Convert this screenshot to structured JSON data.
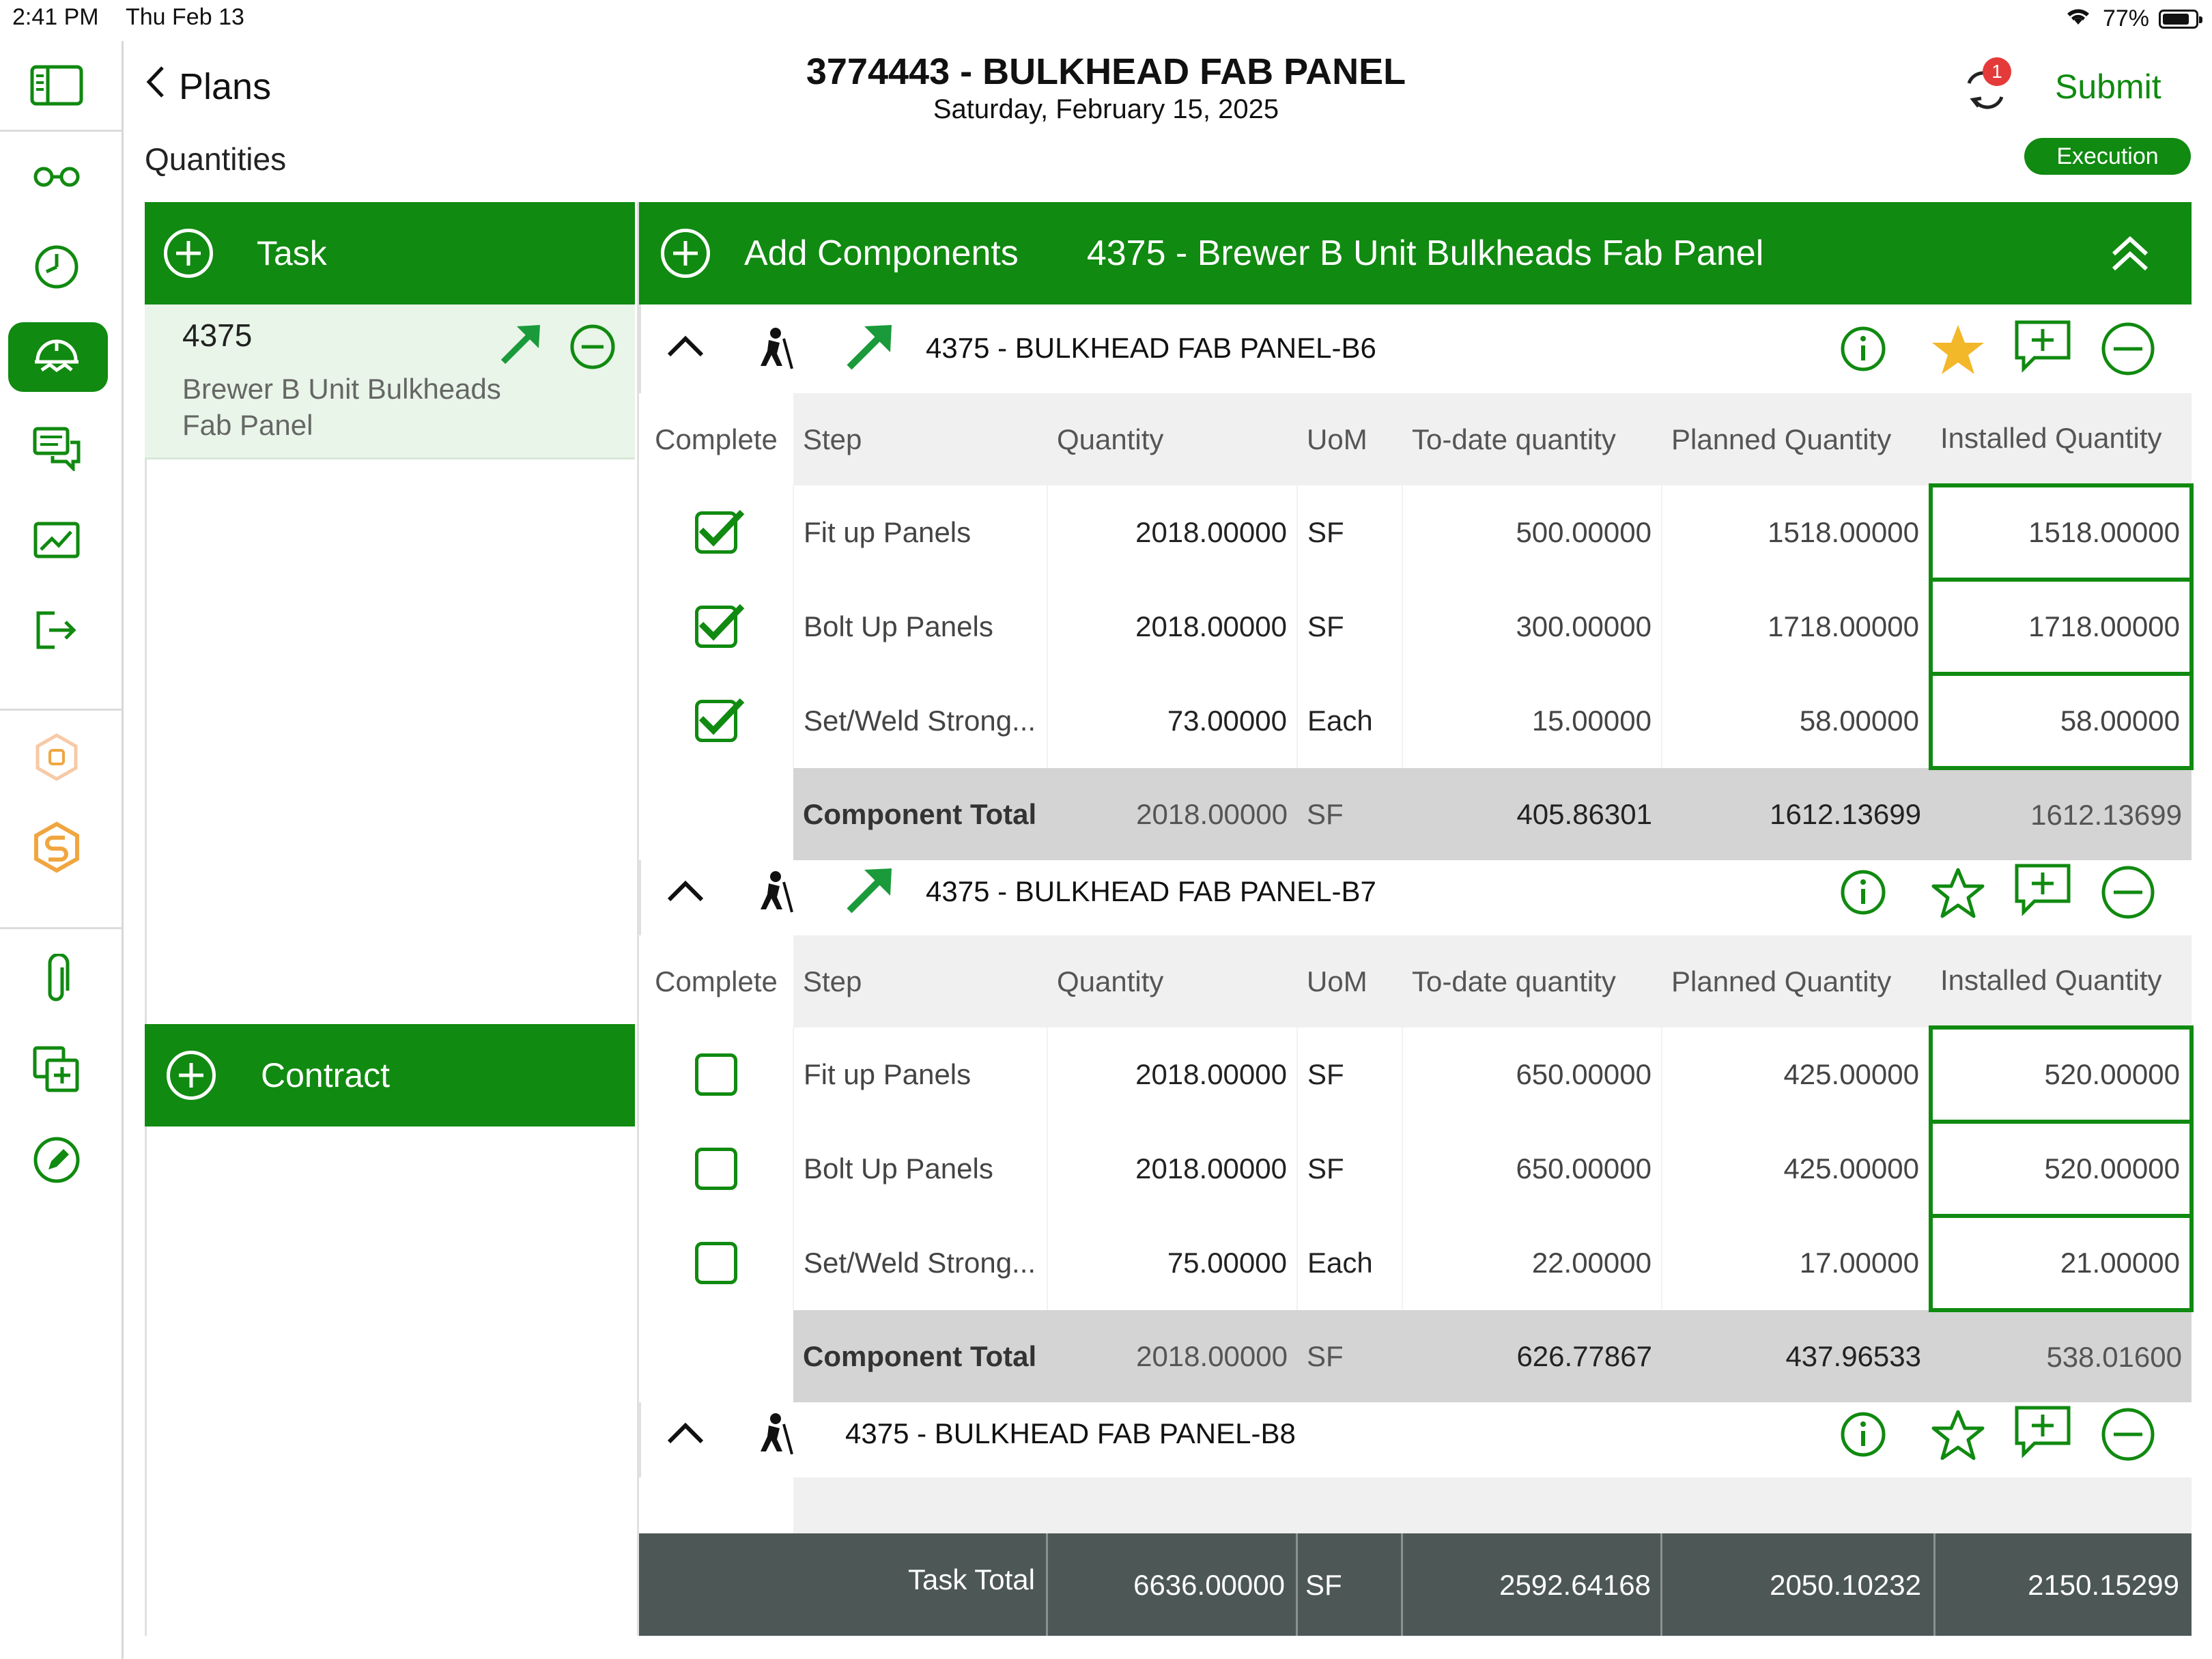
{
  "status_bar": {
    "time": "2:41 PM",
    "date": "Thu Feb 13",
    "battery": "77%"
  },
  "header": {
    "back_label": "Plans",
    "title": "3774443 - BULKHEAD FAB PANEL",
    "subtitle": "Saturday, February 15, 2025",
    "section": "Quantities",
    "submit_label": "Submit",
    "sync_badge": "1",
    "mode_badge": "Execution"
  },
  "left_panel": {
    "task_label": "Task",
    "task_item": {
      "id": "4375",
      "name_line1": "Brewer B Unit Bulkheads",
      "name_line2": "Fab Panel"
    },
    "contract_label": "Contract"
  },
  "components_bar": {
    "add_label": "Add Components",
    "task_title": "4375 - Brewer B Unit Bulkheads Fab Panel"
  },
  "columns": [
    "Complete",
    "Step",
    "Quantity",
    "UoM",
    "To-date quantity",
    "Planned Quantity",
    "Installed Quantity"
  ],
  "components": [
    {
      "title": "4375 - BULKHEAD FAB PANEL-B6",
      "favorite": true,
      "rows": [
        {
          "complete": true,
          "step": "Fit up Panels",
          "quantity": "2018.00000",
          "uom": "SF",
          "todate": "500.00000",
          "planned": "1518.00000",
          "installed": "1518.00000"
        },
        {
          "complete": true,
          "step": "Bolt Up Panels",
          "quantity": "2018.00000",
          "uom": "SF",
          "todate": "300.00000",
          "planned": "1718.00000",
          "installed": "1718.00000"
        },
        {
          "complete": true,
          "step": "Set/Weld Strong...",
          "quantity": "73.00000",
          "uom": "Each",
          "todate": "15.00000",
          "planned": "58.00000",
          "installed": "58.00000"
        }
      ],
      "total": {
        "label": "Component Total",
        "quantity": "2018.00000",
        "uom": "SF",
        "todate": "405.86301",
        "planned": "1612.13699",
        "installed": "1612.13699"
      }
    },
    {
      "title": "4375 - BULKHEAD FAB PANEL-B7",
      "favorite": false,
      "rows": [
        {
          "complete": false,
          "step": "Fit up Panels",
          "quantity": "2018.00000",
          "uom": "SF",
          "todate": "650.00000",
          "planned": "425.00000",
          "installed": "520.00000"
        },
        {
          "complete": false,
          "step": "Bolt Up Panels",
          "quantity": "2018.00000",
          "uom": "SF",
          "todate": "650.00000",
          "planned": "425.00000",
          "installed": "520.00000"
        },
        {
          "complete": false,
          "step": "Set/Weld Strong...",
          "quantity": "75.00000",
          "uom": "Each",
          "todate": "22.00000",
          "planned": "17.00000",
          "installed": "21.00000"
        }
      ],
      "total": {
        "label": "Component Total",
        "quantity": "2018.00000",
        "uom": "SF",
        "todate": "626.77867",
        "planned": "437.96533",
        "installed": "538.01600"
      }
    },
    {
      "title": "4375 - BULKHEAD FAB PANEL-B8",
      "favorite": false
    }
  ],
  "task_total": {
    "label": "Task Total",
    "quantity": "6636.00000",
    "uom": "SF",
    "todate": "2592.64168",
    "planned": "2050.10232",
    "installed": "2150.15299"
  },
  "colors": {
    "brand_green": "#108a10",
    "footer_gray": "#4d5756",
    "badge_red": "#e53a3a",
    "star_gold": "#f3b72a",
    "orange_icon": "#f0a640"
  }
}
